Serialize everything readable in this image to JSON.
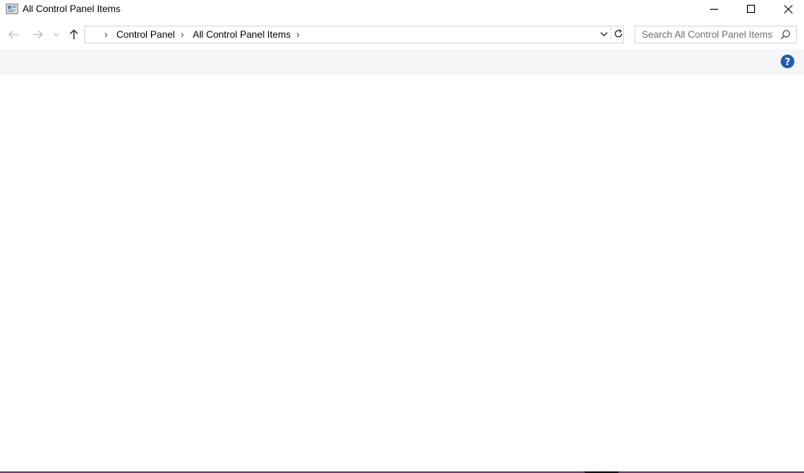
{
  "window": {
    "title": "All Control Panel Items",
    "icon": "control-panel-icon",
    "controls": [
      "minimize-icon",
      "maximize-icon",
      "close-icon"
    ]
  },
  "navigation": {
    "back_icon": "back-arrow-icon",
    "forward_icon": "forward-arrow-icon",
    "recent_icon": "recent-locations-chevron-icon",
    "up_icon": "up-arrow-icon"
  },
  "address": {
    "separator": "›",
    "breadcrumbs": [
      "Control Panel",
      "All Control Panel Items"
    ],
    "dropdown_icon": "chevron-down-icon",
    "refresh_icon": "refresh-icon"
  },
  "search": {
    "placeholder": "Search All Control Panel Items",
    "value": "",
    "icon": "search-icon"
  },
  "commandbar": {
    "help_label": "?",
    "help_icon": "help-icon",
    "help_color": "#1e5eb6"
  },
  "colors": {
    "commandbar_bg": "#f5f6f7",
    "taskbar_accent": "#7d3a78"
  }
}
